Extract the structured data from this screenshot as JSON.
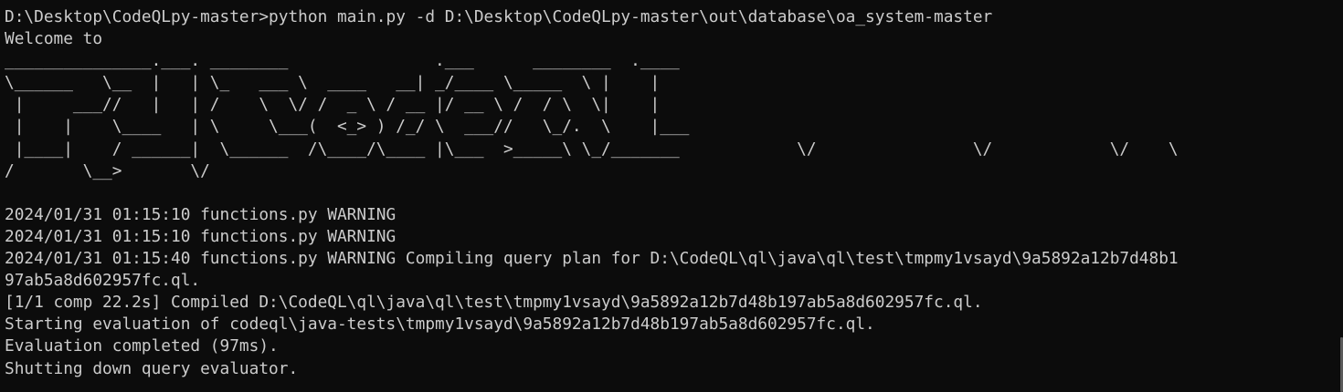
{
  "terminal": {
    "lines": [
      "D:\\Desktop\\CodeQLpy-master>python main.py -d D:\\Desktop\\CodeQLpy-master\\out\\database\\oa_system-master",
      "Welcome to",
      "_______________.___. ________               .___      ________  .____",
      "\\______   \\__  |   | \\_   ___ \\  ____   __| _/____ \\_____  \\ |    |",
      " |     ___//   |   | /    \\  \\/ /  _ \\ / __ |/ __ \\ /  / \\  \\|    |",
      " |    |    \\____   | \\     \\___(  <_> ) /_/ \\  ___//   \\_/.  \\    |___",
      " |____|    / ______|  \\______  /\\____/\\____ |\\___  >_____\\ \\_/_______            \\/                \\/            \\/    \\",
      "/       \\__>       \\/",
      "",
      "2024/01/31 01:15:10 functions.py WARNING",
      "2024/01/31 01:15:10 functions.py WARNING",
      "2024/01/31 01:15:40 functions.py WARNING Compiling query plan for D:\\CodeQL\\ql\\java\\ql\\test\\tmpmy1vsayd\\9a5892a12b7d48b1",
      "97ab5a8d602957fc.ql.",
      "[1/1 comp 22.2s] Compiled D:\\CodeQL\\ql\\java\\ql\\test\\tmpmy1vsayd\\9a5892a12b7d48b197ab5a8d602957fc.ql.",
      "Starting evaluation of codeql\\java-tests\\tmpmy1vsayd\\9a5892a12b7d48b197ab5a8d602957fc.ql.",
      "Evaluation completed (97ms).",
      "Shutting down query evaluator."
    ]
  },
  "colors": {
    "background": "#0c0c0c",
    "foreground": "#cccccc",
    "scrollbar_thumb": "#5a5a5a"
  }
}
